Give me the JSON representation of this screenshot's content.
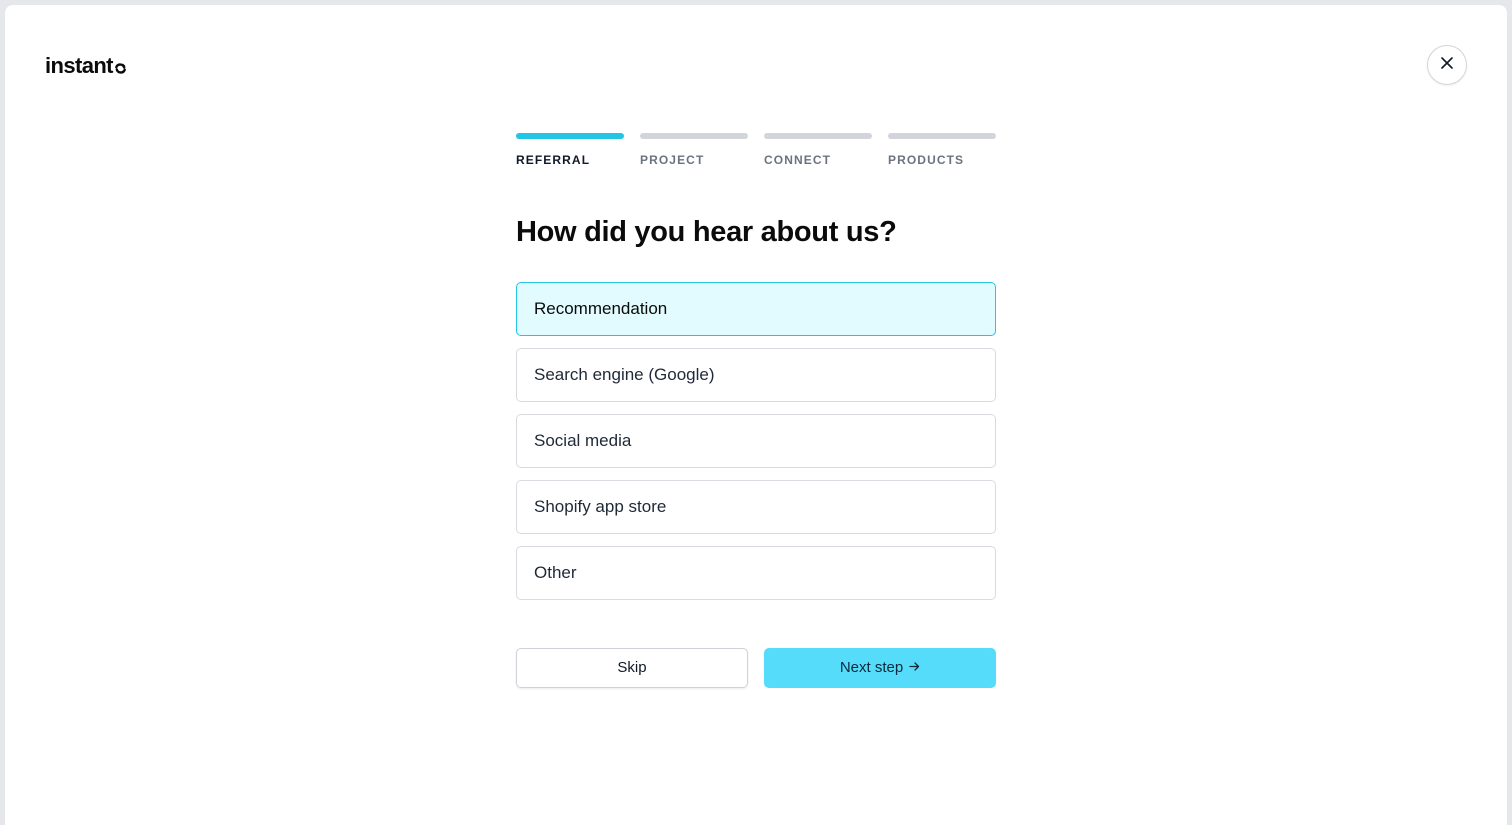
{
  "brand": {
    "name": "instant",
    "logo_icon": "refresh-icon"
  },
  "close": {
    "icon": "close-icon"
  },
  "stepper": {
    "steps": [
      {
        "label": "REFERRAL",
        "active": true
      },
      {
        "label": "PROJECT",
        "active": false
      },
      {
        "label": "CONNECT",
        "active": false
      },
      {
        "label": "PRODUCTS",
        "active": false
      }
    ]
  },
  "question": {
    "title": "How did you hear about us?"
  },
  "options": [
    {
      "label": "Recommendation",
      "selected": true
    },
    {
      "label": "Search engine (Google)",
      "selected": false
    },
    {
      "label": "Social media",
      "selected": false
    },
    {
      "label": "Shopify app store",
      "selected": false
    },
    {
      "label": "Other",
      "selected": false
    }
  ],
  "actions": {
    "skip_label": "Skip",
    "next_label": "Next step",
    "next_icon": "arrow-right-icon"
  },
  "colors": {
    "accent": "#22c5e5",
    "selected_bg": "#e1fbfe",
    "next_button": "#55dcfb",
    "inactive_bar": "#d1d5db"
  }
}
